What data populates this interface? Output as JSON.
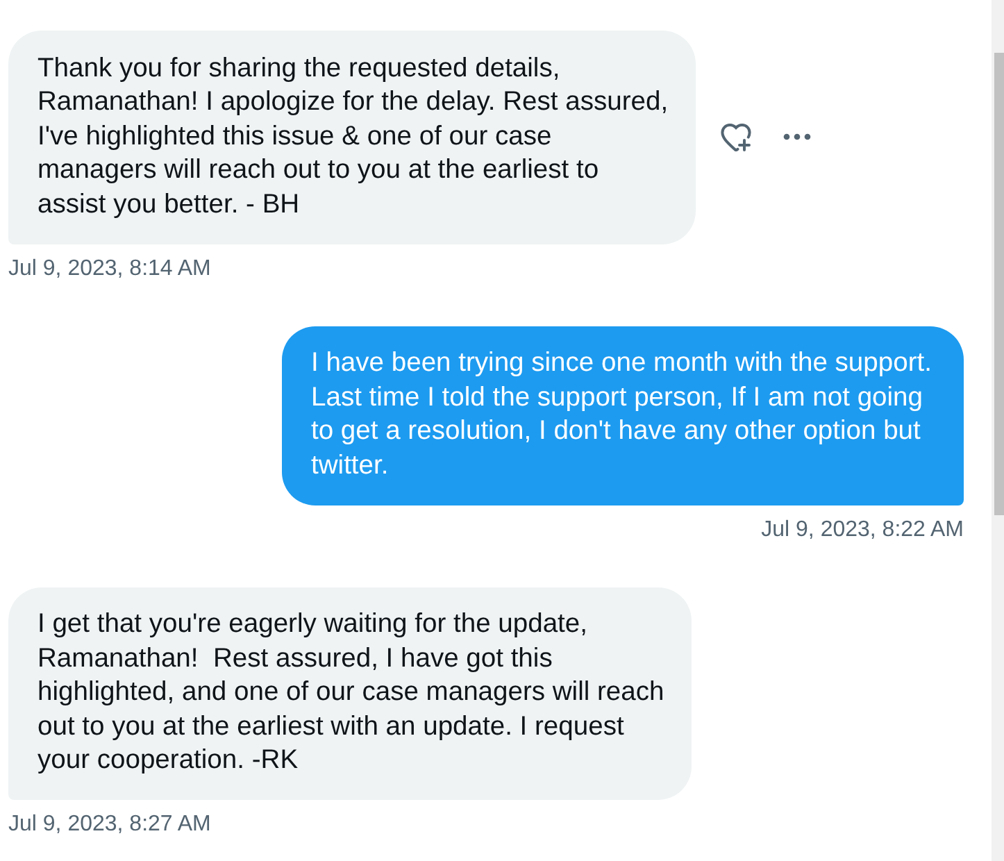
{
  "messages": [
    {
      "kind": "received",
      "text": "Thank you for sharing the requested details,\nRamanathan! I apologize for the delay. Rest assured,\nI've highlighted this issue & one of our case\nmanagers will reach out to you at the earliest to\nassist you better. - BH",
      "timestamp": "Jul 9, 2023, 8:14 AM",
      "actions_shown": true
    },
    {
      "kind": "sent",
      "text": "I have been trying since one month with the support.\nLast time I told the support person, If I am not going\nto get a resolution, I don't have any other option but\ntwitter.",
      "timestamp": "Jul 9, 2023, 8:22 AM",
      "actions_shown": false
    },
    {
      "kind": "received",
      "text": "I get that you're eagerly waiting for the update,\nRamanathan!  Rest assured, I have got this\nhighlighted, and one of our case managers will reach\nout to you at the earliest with an update. I request\nyour cooperation. -RK",
      "timestamp": "Jul 9, 2023, 8:27 AM",
      "actions_shown": false
    }
  ]
}
